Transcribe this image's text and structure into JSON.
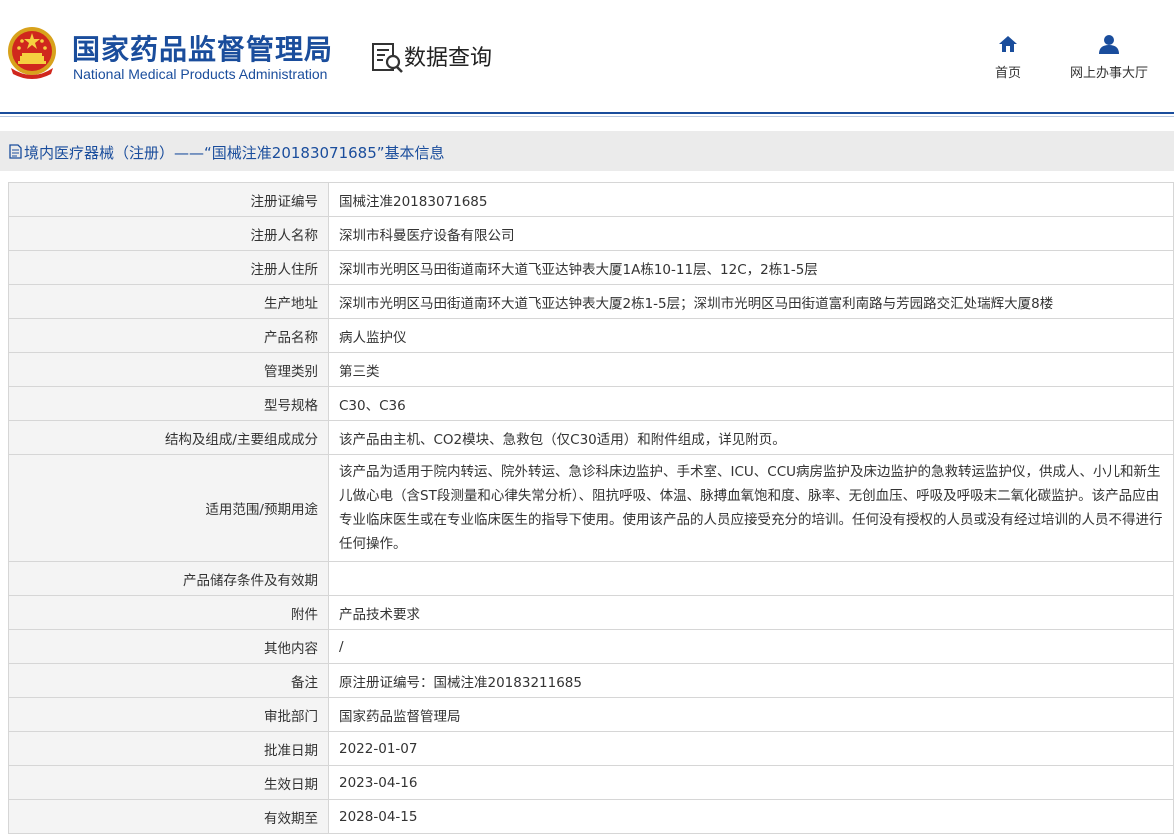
{
  "header": {
    "org_cn": "国家药品监督管理局",
    "org_en": "National Medical Products Administration",
    "query_title": "数据查询",
    "nav": {
      "home": "首页",
      "hall": "网上办事大厅"
    }
  },
  "section": {
    "title": "境内医疗器械（注册）——“国械注准20183071685”基本信息"
  },
  "rows": [
    {
      "label": "注册证编号",
      "value": "国械注准20183071685"
    },
    {
      "label": "注册人名称",
      "value": "深圳市科曼医疗设备有限公司"
    },
    {
      "label": "注册人住所",
      "value": "深圳市光明区马田街道南环大道飞亚达钟表大厦1A栋10-11层、12C，2栋1-5层"
    },
    {
      "label": "生产地址",
      "value": "深圳市光明区马田街道南环大道飞亚达钟表大厦2栋1-5层；深圳市光明区马田街道富利南路与芳园路交汇处瑞辉大厦8楼"
    },
    {
      "label": "产品名称",
      "value": "病人监护仪"
    },
    {
      "label": "管理类别",
      "value": "第三类"
    },
    {
      "label": "型号规格",
      "value": "C30、C36"
    },
    {
      "label": "结构及组成/主要组成成分",
      "value": "该产品由主机、CO2模块、急救包（仅C30适用）和附件组成，详见附页。"
    },
    {
      "label": "适用范围/预期用途",
      "value": "该产品为适用于院内转运、院外转运、急诊科床边监护、手术室、ICU、CCU病房监护及床边监护的急救转运监护仪，供成人、小儿和新生儿做心电（含ST段测量和心律失常分析）、阻抗呼吸、体温、脉搏血氧饱和度、脉率、无创血压、呼吸及呼吸末二氧化碳监护。该产品应由专业临床医生或在专业临床医生的指导下使用。使用该产品的人员应接受充分的培训。任何没有授权的人员或没有经过培训的人员不得进行任何操作。"
    },
    {
      "label": "产品储存条件及有效期",
      "value": ""
    },
    {
      "label": "附件",
      "value": "产品技术要求"
    },
    {
      "label": "其他内容",
      "value": "/"
    },
    {
      "label": "备注",
      "value": "原注册证编号：国械注准20183211685"
    },
    {
      "label": "审批部门",
      "value": "国家药品监督管理局"
    },
    {
      "label": "批准日期",
      "value": "2022-01-07"
    },
    {
      "label": "生效日期",
      "value": "2023-04-16"
    },
    {
      "label": "有效期至",
      "value": "2028-04-15"
    }
  ],
  "colors": {
    "brand_blue": "#1a4d9c",
    "label_bg": "#f4f4f4",
    "title_bar_bg": "#ebebeb"
  }
}
